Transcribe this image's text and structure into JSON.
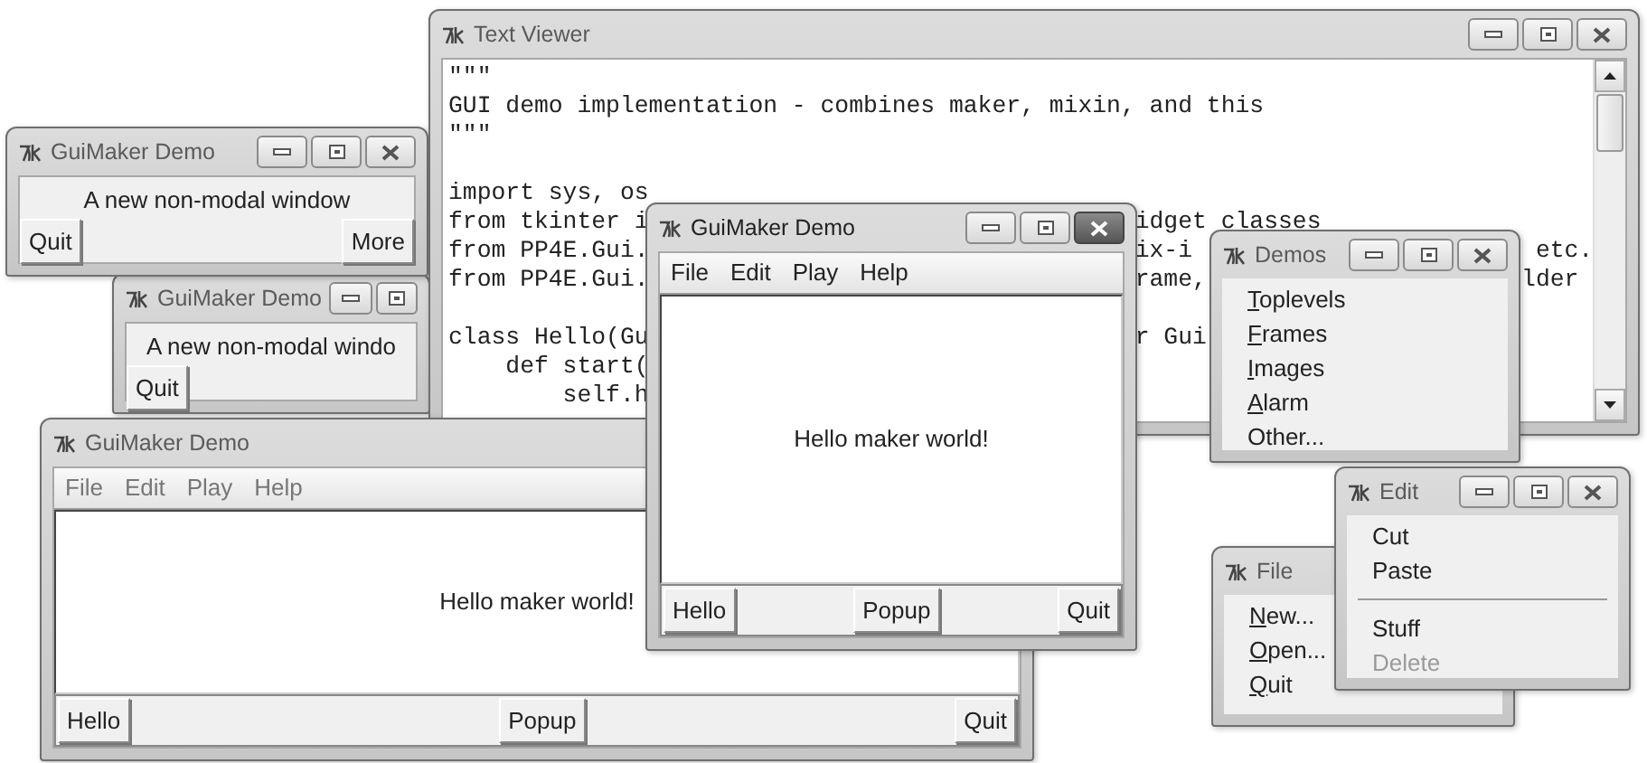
{
  "windows": [
    {
      "kind": "message",
      "title": "GuiMaker Demo",
      "active": false,
      "controls": [
        {
          "kind": "minimize"
        },
        {
          "kind": "maximize"
        },
        {
          "kind": "close"
        }
      ],
      "message": "A new non-modal window",
      "buttons": [
        "Quit",
        "More"
      ]
    },
    {
      "kind": "message",
      "title": "GuiMaker Demo",
      "active": false,
      "controls": [
        {
          "kind": "minimize"
        },
        {
          "kind": "maximize"
        }
      ],
      "message": "A new non-modal windo",
      "buttons": [
        "Quit"
      ]
    },
    {
      "kind": "text",
      "title": "Text Viewer",
      "active": false,
      "controls": [
        {
          "kind": "minimize"
        },
        {
          "kind": "maximize"
        },
        {
          "kind": "close"
        }
      ],
      "lines": [
        {
          "kind": "code",
          "segments": [
            "\"\"\""
          ]
        },
        {
          "kind": "code",
          "segments": [
            "GUI demo implementation - combines maker, mixin, and this"
          ]
        },
        {
          "kind": "code",
          "segments": [
            "\"\"\""
          ]
        },
        {
          "kind": "blank"
        },
        {
          "kind": "code",
          "segments": [
            "import sys, os"
          ]
        },
        {
          "kind": "code",
          "segments": [
            "from tkinter i",
            "idget classes"
          ]
        },
        {
          "kind": "code",
          "segments": [
            "from PP4E.Gui.",
            "ix-i",
            "etc."
          ]
        },
        {
          "kind": "code",
          "segments": [
            "from PP4E.Gui.",
            "rame,",
            "lder"
          ]
        },
        {
          "kind": "blank"
        },
        {
          "kind": "code",
          "segments": [
            "class Hello(Gu",
            "r Gui"
          ]
        },
        {
          "kind": "code",
          "segments": [
            "    def start("
          ]
        },
        {
          "kind": "code",
          "segments": [
            "        self.h"
          ]
        }
      ]
    },
    {
      "kind": "maker",
      "title": "GuiMaker Demo",
      "active": false,
      "menu": [
        "File",
        "Edit",
        "Play",
        "Help"
      ],
      "message": "Hello maker world!",
      "buttons": [
        "Hello",
        "Popup",
        "Quit"
      ]
    },
    {
      "kind": "maker",
      "title": "GuiMaker Demo",
      "active": true,
      "controls": [
        {
          "kind": "minimize"
        },
        {
          "kind": "maximize"
        },
        {
          "kind": "close"
        }
      ],
      "menu": [
        "File",
        "Edit",
        "Play",
        "Help"
      ],
      "message": "Hello maker world!",
      "buttons": [
        "Hello",
        "Popup",
        "Quit"
      ]
    },
    {
      "kind": "menu",
      "title": "Demos",
      "active": false,
      "controls": [
        {
          "kind": "minimize"
        },
        {
          "kind": "maximize"
        },
        {
          "kind": "close"
        }
      ],
      "items": [
        {
          "kind": "item",
          "label": "Toplevels",
          "mnemonic": true,
          "disabled": false
        },
        {
          "kind": "item",
          "label": "Frames",
          "mnemonic": true,
          "disabled": false
        },
        {
          "kind": "item",
          "label": "Images",
          "mnemonic": true,
          "disabled": false
        },
        {
          "kind": "item",
          "label": "Alarm",
          "mnemonic": true,
          "disabled": false
        },
        {
          "kind": "item",
          "label": "Other...",
          "mnemonic": false,
          "disabled": false
        }
      ]
    },
    {
      "kind": "menu",
      "title": "File",
      "active": false,
      "items": [
        {
          "kind": "item",
          "label": "New...",
          "mnemonic": true,
          "disabled": false
        },
        {
          "kind": "item",
          "label": "Open...",
          "mnemonic": true,
          "disabled": false
        },
        {
          "kind": "item",
          "label": "Quit",
          "mnemonic": true,
          "disabled": false
        }
      ]
    },
    {
      "kind": "menu",
      "title": "Edit",
      "active": false,
      "controls": [
        {
          "kind": "minimize"
        },
        {
          "kind": "maximize"
        },
        {
          "kind": "close"
        }
      ],
      "items": [
        {
          "kind": "item",
          "label": "Cut",
          "mnemonic": false,
          "disabled": false
        },
        {
          "kind": "item",
          "label": "Paste",
          "mnemonic": false,
          "disabled": false
        },
        {
          "kind": "separator"
        },
        {
          "kind": "item",
          "label": "Stuff",
          "mnemonic": false,
          "disabled": false
        },
        {
          "kind": "item",
          "label": "Delete",
          "mnemonic": false,
          "disabled": true
        }
      ]
    }
  ]
}
